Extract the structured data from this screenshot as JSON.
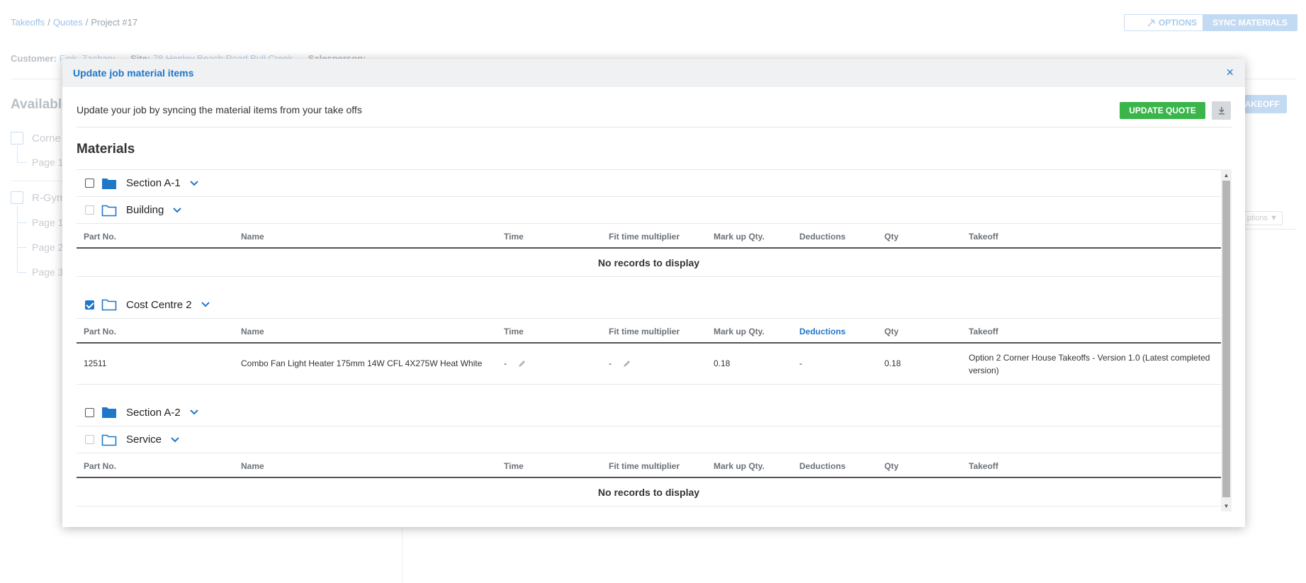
{
  "breadcrumb": {
    "item1": "Takeoffs",
    "item2": "Quotes",
    "item3": "Project #17",
    "sep": "/"
  },
  "header_buttons": {
    "options": "OPTIONS",
    "sync": "SYNC MATERIALS"
  },
  "customer_row": {
    "customer_label": "Customer:",
    "customer_value": "Fink, Zachary",
    "site_label": "Site:",
    "site_value": "78 Henley Beach Road Bull Creek",
    "salesperson_label": "Salesperson:"
  },
  "available": {
    "title": "Available"
  },
  "tree": {
    "item1": "Corne",
    "item1_page": "Page 1",
    "item2": "R-Gym",
    "item2_pages": [
      "Page 1",
      "Page 2",
      "Page 3"
    ]
  },
  "right_panel": {
    "takeoff_button": "AKEOFF",
    "options_dropdown": "ptions ▼"
  },
  "modal": {
    "title": "Update job material items",
    "close": "×",
    "intro": "Update your job by syncing the material items from your take offs",
    "update_button": "UPDATE QUOTE",
    "materials_title": "Materials",
    "columns": [
      "Part No.",
      "Name",
      "Time",
      "Fit time multiplier",
      "Mark up Qty.",
      "Deductions",
      "Qty",
      "Takeoff"
    ],
    "groups": {
      "section_a1": "Section A-1",
      "building": "Building",
      "cost_centre_2": "Cost Centre 2",
      "section_a2": "Section A-2",
      "service": "Service"
    },
    "no_records": "No records to display",
    "row": {
      "part_no": "12511",
      "name": "Combo Fan Light Heater 175mm 14W CFL 4X275W Heat White",
      "time": "-",
      "fit_time": "-",
      "markup_qty": "0.18",
      "deductions": "-",
      "qty": "0.18",
      "takeoff": "Option 2 Corner House Takeoffs - Version 1.0 (Latest completed version)"
    }
  },
  "colors": {
    "accent": "#1f77c9",
    "success": "#39b54a"
  }
}
